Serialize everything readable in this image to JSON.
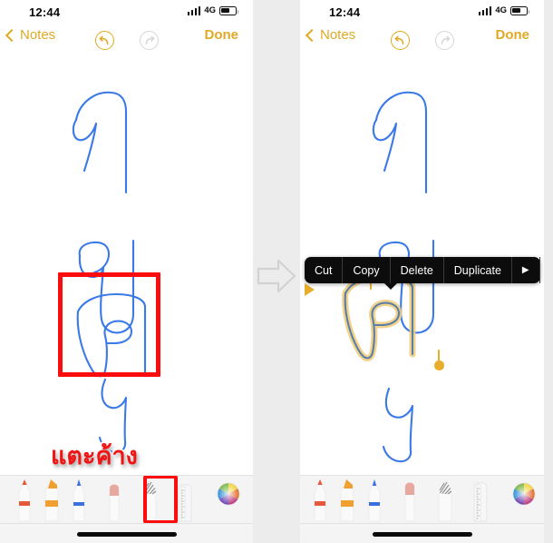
{
  "meta": {
    "app_name": "Notes",
    "screenshot_width": 610,
    "screenshot_height": 598,
    "accent_color": "#e0a924",
    "marker_color": "#fb0d0d",
    "ink_color": "#3b79e8",
    "selection_color": "#e8ad2a",
    "menu_background": "#0c0c0c",
    "panel_background": "#ffffff",
    "page_background": "#ececec",
    "toolbar_background": "#f4f4f4"
  },
  "statusbar": {
    "time": "12:44",
    "network": "4G",
    "signal_icon": "cellular-signal-icon",
    "battery_icon": "battery-icon"
  },
  "navbar": {
    "back_label": "Notes",
    "back_icon": "chevron-left-icon",
    "undo_icon": "undo-icon",
    "redo_icon": "redo-icon",
    "done_label": "Done"
  },
  "context_menu": {
    "items": [
      {
        "label": "Cut",
        "name": "menu-item-cut"
      },
      {
        "label": "Copy",
        "name": "menu-item-copy"
      },
      {
        "label": "Delete",
        "name": "menu-item-delete"
      },
      {
        "label": "Duplicate",
        "name": "menu-item-duplicate"
      },
      {
        "label": "▶",
        "name": "menu-item-more"
      }
    ]
  },
  "annotation": {
    "caption_thai": "แตะค้าง",
    "caption_meaning": "tap and hold",
    "highlight_box_name": "red-highlight-box",
    "step_arrow_icon": "arrow-right-icon"
  },
  "canvas": {
    "strokes_description": "handwritten Thai letters drawn in blue ink",
    "characters": [
      "ก",
      "ข",
      "ค",
      "ง"
    ]
  },
  "toolbar": {
    "tools": [
      {
        "name": "tool-pen",
        "label": "Pen",
        "color": "#e8583c"
      },
      {
        "name": "tool-highlighter",
        "label": "Highlighter",
        "color": "#f0a030"
      },
      {
        "name": "tool-pencil",
        "label": "Pencil",
        "color": "#3b6fe0"
      },
      {
        "name": "tool-eraser",
        "label": "Eraser",
        "color": "#e8a8a0"
      },
      {
        "name": "tool-lasso",
        "label": "Lasso Select",
        "color": "#9a9a9a"
      },
      {
        "name": "tool-ruler",
        "label": "Ruler",
        "color": "#cfcfcf"
      },
      {
        "name": "tool-color-wheel",
        "label": "Color",
        "color": "#7ab648"
      }
    ],
    "selected_tool": "tool-lasso",
    "home_indicator": "home-indicator"
  },
  "panels": [
    {
      "id": "panel-before",
      "state": "lasso tool selected, stroke circled in red"
    },
    {
      "id": "panel-after",
      "state": "selection made, context menu visible"
    }
  ]
}
